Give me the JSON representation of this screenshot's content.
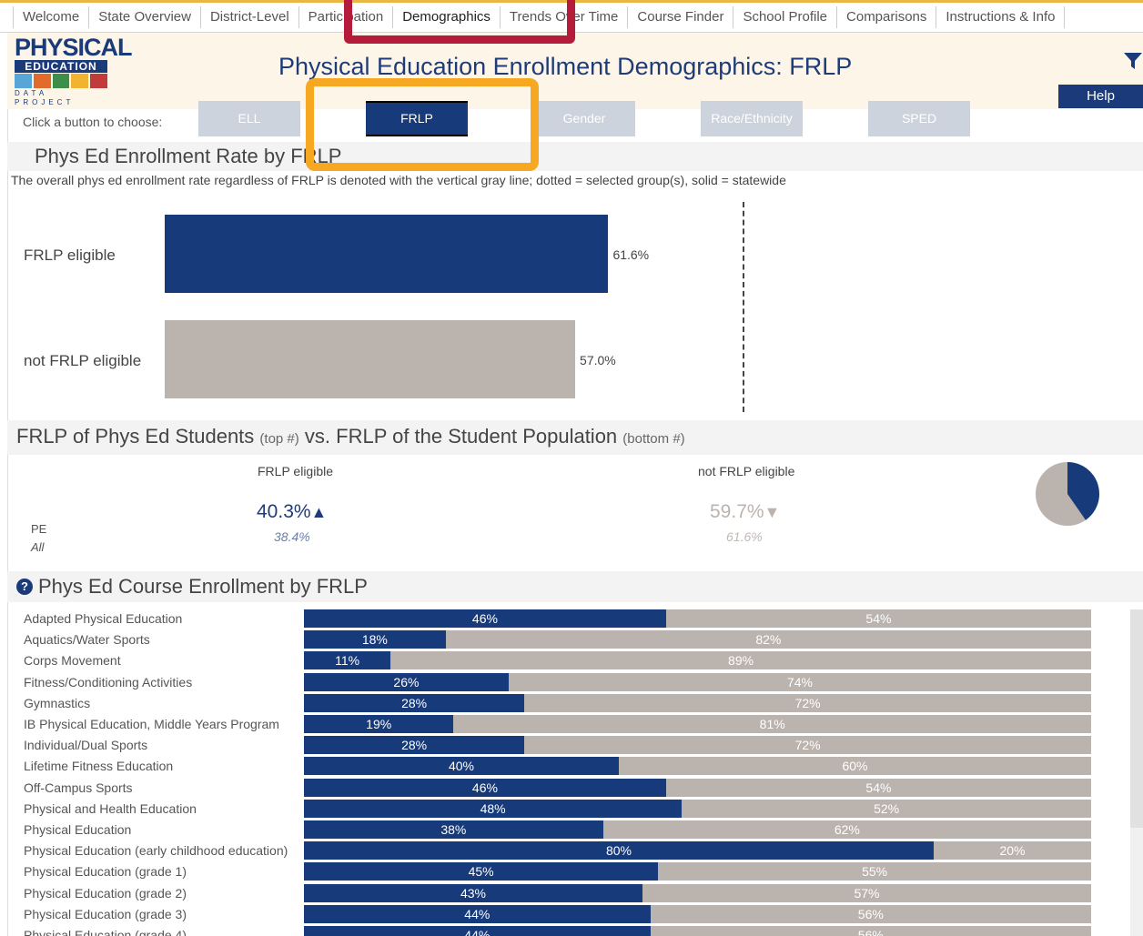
{
  "nav": {
    "tabs": [
      "Welcome",
      "State Overview",
      "District-Level",
      "Participation",
      "Demographics",
      "Trends Over Time",
      "Course Finder",
      "School Profile",
      "Comparisons",
      "Instructions & Info"
    ],
    "active": "Demographics"
  },
  "header": {
    "title": "Physical Education Enrollment Demographics: FRLP",
    "help_label": "Help",
    "logo": {
      "line1": "PHYSICAL",
      "line2": "EDUCATION",
      "line3": "DATA PROJECT"
    }
  },
  "chooser": {
    "label": "Click a button to choose:",
    "buttons": [
      "ELL",
      "FRLP",
      "Gender",
      "Race/Ethnicity",
      "SPED"
    ],
    "active": "FRLP"
  },
  "rate_section": {
    "title": "Phys Ed Enrollment Rate by FRLP",
    "note": "The overall phys ed enrollment rate regardless of FRLP is denoted with the vertical gray line; dotted = selected group(s), solid = statewide",
    "rows": [
      {
        "label": "FRLP eligible",
        "value": 61.6,
        "display": "61.6%",
        "color": "#163a7a"
      },
      {
        "label": "not FRLP eligible",
        "value": 57.0,
        "display": "57.0%",
        "color": "#bbb3ae"
      }
    ],
    "reference_line": 56.9,
    "axis_max": 92.0
  },
  "share_section": {
    "title": "FRLP of Phys Ed Students",
    "title_top": "(top #)",
    "title_mid": "vs. FRLP of the Student Population",
    "title_bottom": "(bottom #)",
    "row_label_1": "PE",
    "row_label_2": "All",
    "columns": [
      {
        "head": "FRLP eligible",
        "top": "40.3%",
        "arrow": "▲",
        "bottom": "38.4%",
        "color": "#1f3b78",
        "sub_color": "#6b7fa6"
      },
      {
        "head": "not FRLP eligible",
        "top": "59.7%",
        "arrow": "▼",
        "bottom": "61.6%",
        "color": "#bbb3ae",
        "sub_color": "#c0b9b4"
      }
    ],
    "pie": {
      "frlp": 40.3,
      "not_frlp": 59.7
    }
  },
  "course_section": {
    "help_icon": "?",
    "title": "Phys Ed Course Enrollment by FRLP",
    "courses": [
      {
        "name": "Adapted Physical Education",
        "frlp": 46,
        "not": 54
      },
      {
        "name": "Aquatics/Water Sports",
        "frlp": 18,
        "not": 82
      },
      {
        "name": "Corps Movement",
        "frlp": 11,
        "not": 89
      },
      {
        "name": "Fitness/Conditioning Activities",
        "frlp": 26,
        "not": 74
      },
      {
        "name": "Gymnastics",
        "frlp": 28,
        "not": 72
      },
      {
        "name": "IB Physical Education, Middle Years Program",
        "frlp": 19,
        "not": 81
      },
      {
        "name": "Individual/Dual Sports",
        "frlp": 28,
        "not": 72
      },
      {
        "name": "Lifetime Fitness Education",
        "frlp": 40,
        "not": 60
      },
      {
        "name": "Off-Campus Sports",
        "frlp": 46,
        "not": 54
      },
      {
        "name": "Physical and Health Education",
        "frlp": 48,
        "not": 52
      },
      {
        "name": "Physical Education",
        "frlp": 38,
        "not": 62
      },
      {
        "name": "Physical Education (early childhood education)",
        "frlp": 80,
        "not": 20
      },
      {
        "name": "Physical Education (grade 1)",
        "frlp": 45,
        "not": 55
      },
      {
        "name": "Physical Education (grade 2)",
        "frlp": 43,
        "not": 57
      },
      {
        "name": "Physical Education (grade 3)",
        "frlp": 44,
        "not": 56
      },
      {
        "name": "Physical Education (grade 4)",
        "frlp": 44,
        "not": 56
      }
    ]
  }
}
